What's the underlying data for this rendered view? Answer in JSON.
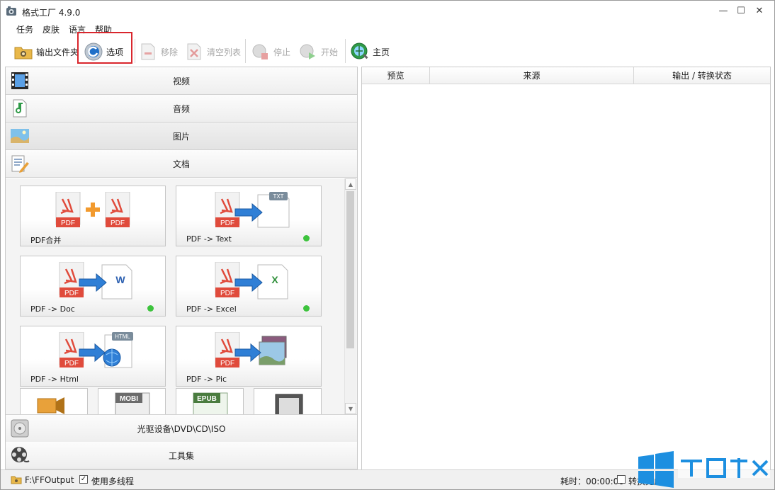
{
  "window": {
    "title": "格式工厂 4.9.0",
    "minimize": "—",
    "maximize": "☐",
    "close": "✕"
  },
  "menu": [
    "任务",
    "皮肤",
    "语言",
    "帮助"
  ],
  "toolbar": {
    "output_folder": "输出文件夹",
    "options": "选项",
    "remove": "移除",
    "clear_list": "清空列表",
    "stop": "停止",
    "start": "开始",
    "home": "主页"
  },
  "categories": {
    "video": "视频",
    "audio": "音频",
    "picture": "图片",
    "document": "文档",
    "disc": "光驱设备\\DVD\\CD\\ISO",
    "tools": "工具集"
  },
  "tiles": [
    {
      "label": "PDF合并",
      "badge": "PDF",
      "status": false
    },
    {
      "label": "PDF -> Text",
      "badge": "TXT",
      "status": true
    },
    {
      "label": "PDF -> Doc",
      "badge": "W",
      "status": true
    },
    {
      "label": "PDF -> Excel",
      "badge": "X",
      "status": true
    },
    {
      "label": "PDF -> Html",
      "badge": "HTML",
      "status": false
    },
    {
      "label": "PDF -> Pic",
      "badge": "",
      "status": false
    }
  ],
  "small_tiles": [
    "",
    "MOBI",
    "EPUB",
    ""
  ],
  "pdf_label": "PDF",
  "task_table": {
    "columns": [
      "预览",
      "来源",
      "输出 / 转换状态"
    ]
  },
  "statusbar": {
    "output_path": "F:\\FFOutput",
    "multithread_label": "使用多线程",
    "multithread_checked": true,
    "elapsed_label": "耗时：00:00:00",
    "after_convert": "转换完成"
  },
  "colors": {
    "accent_red": "#d9262d",
    "pdf_red": "#e04b3c",
    "status_green": "#3dc33d",
    "arrow_blue": "#2f7fd6"
  }
}
